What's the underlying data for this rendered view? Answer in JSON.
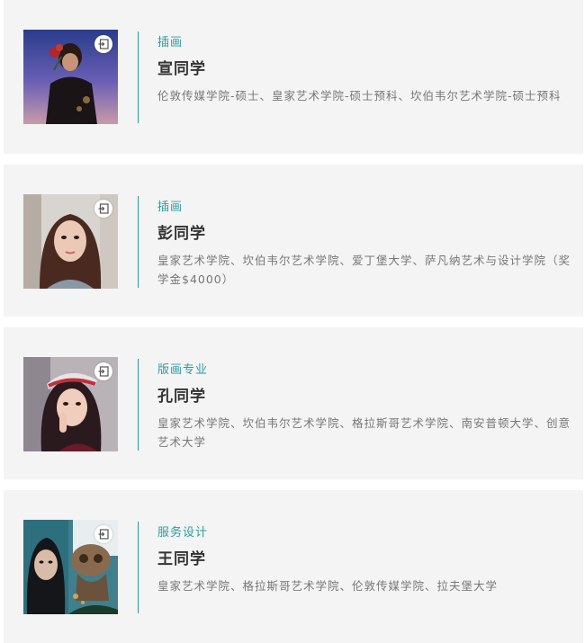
{
  "students": [
    {
      "major": "插画",
      "name": "宣同学",
      "schools": "伦敦传媒学院-硕士、皇家艺术学院-硕士预科、坎伯韦尔艺术学院-硕士预科",
      "photo_icon": "person-photo",
      "action_icon": "enter-icon"
    },
    {
      "major": "插画",
      "name": "彭同学",
      "schools": "皇家艺术学院、坎伯韦尔艺术学院、爱丁堡大学、萨凡纳艺术与设计学院（奖学金$4000）",
      "photo_icon": "person-photo",
      "action_icon": "enter-icon"
    },
    {
      "major": "版画专业",
      "name": "孔同学",
      "schools": "皇家艺术学院、坎伯韦尔艺术学院、格拉斯哥艺术学院、南安普顿大学、创意艺术大学",
      "photo_icon": "person-photo",
      "action_icon": "enter-icon"
    },
    {
      "major": "服务设计",
      "name": "王同学",
      "schools": "皇家艺术学院、格拉斯哥艺术学院、伦敦传媒学院、拉夫堡大学",
      "photo_icon": "person-photo",
      "action_icon": "enter-icon"
    }
  ],
  "colors": {
    "card_background": "#f4f4f4",
    "accent": "#2b9ba0",
    "name_text": "#333333",
    "body_text": "#777777"
  }
}
